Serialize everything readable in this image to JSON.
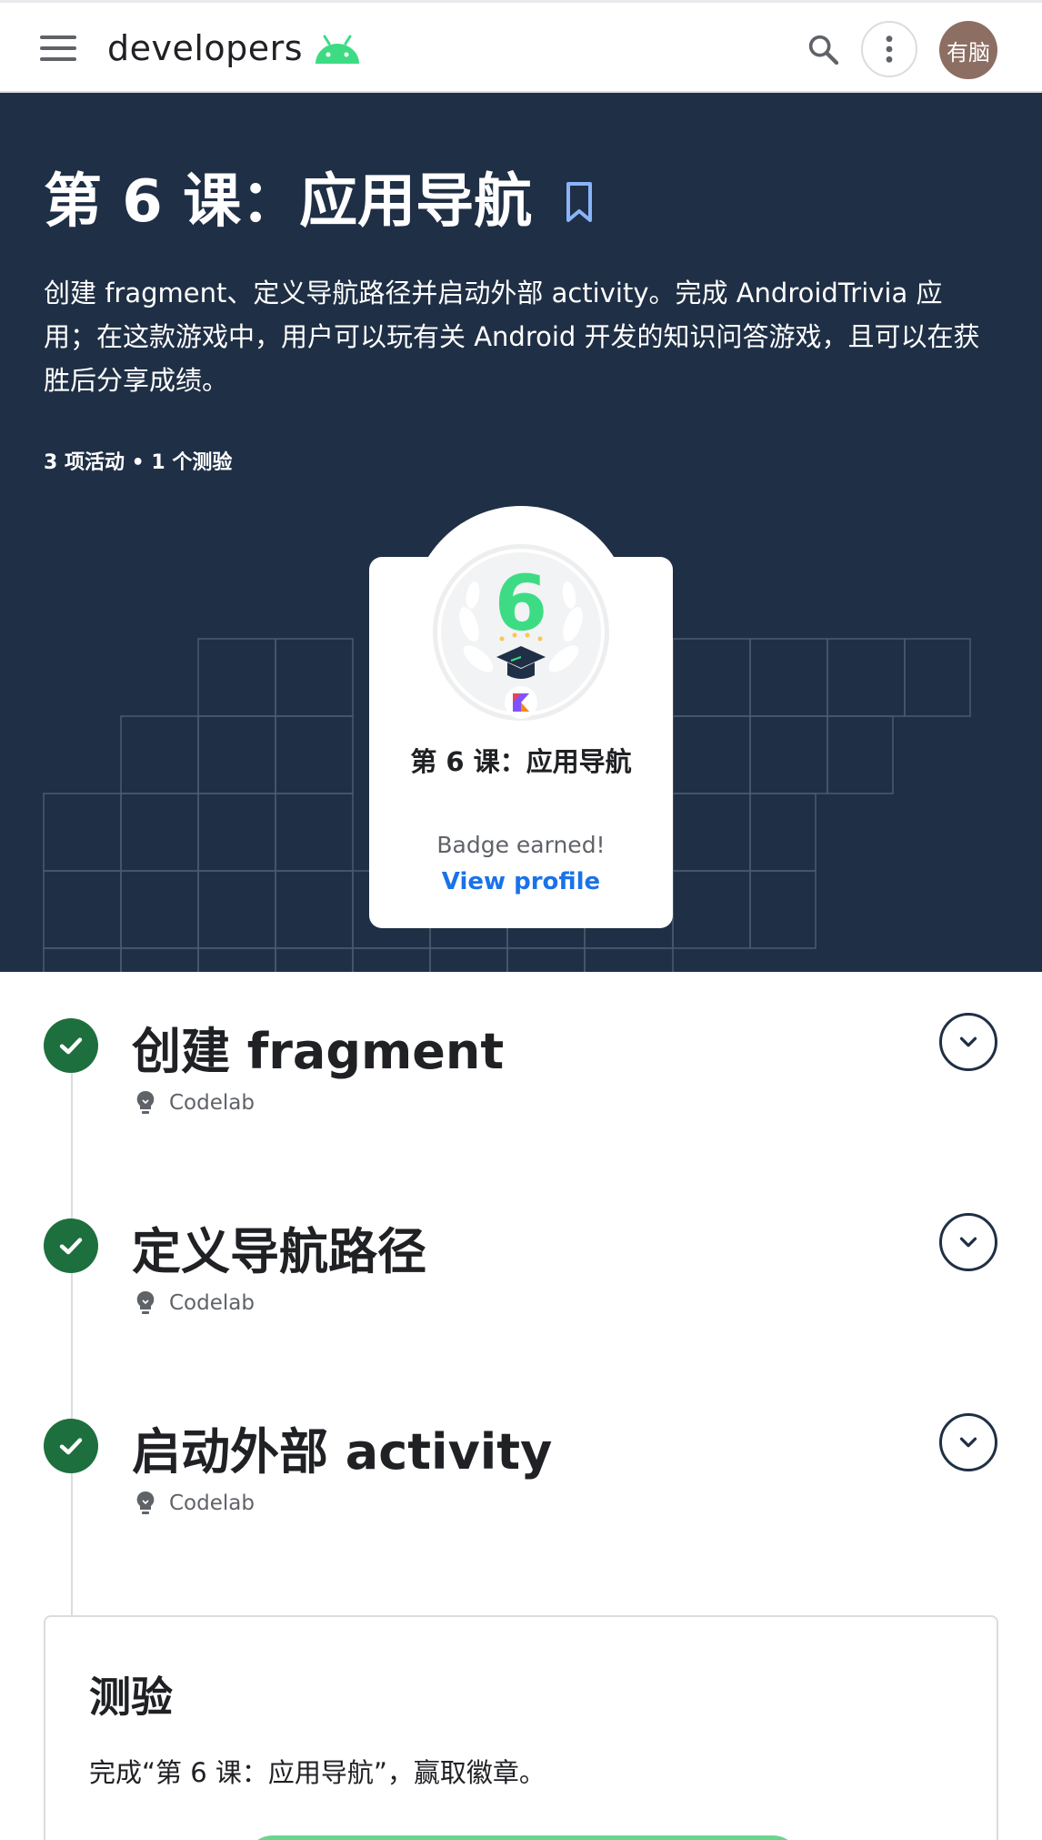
{
  "header": {
    "logo_text": "developers",
    "avatar_text": "有脑",
    "icons": [
      "menu-icon",
      "android-logo-icon",
      "search-icon",
      "more-vert-icon"
    ]
  },
  "hero": {
    "title": "第 6 课：应用导航",
    "description": "创建 fragment、定义导航路径并启动外部 activity。完成 AndroidTrivia 应用；在这款游戏中，用户可以玩有关 Android 开发的知识问答游戏，且可以在获胜后分享成绩。",
    "meta": "3 项活动 • 1 个测验",
    "badge": {
      "number": "6",
      "title": "第 6 课：应用导航",
      "status": "Badge earned!",
      "link": "View profile"
    }
  },
  "activities": [
    {
      "title": "创建 fragment",
      "type": "Codelab"
    },
    {
      "title": "定义导航路径",
      "type": "Codelab"
    },
    {
      "title": "启动外部 activity",
      "type": "Codelab"
    }
  ],
  "quiz": {
    "title": "测验",
    "description": "完成“第 6 课：应用导航”，赢取徽章。"
  },
  "colors": {
    "hero_bg": "#1f2f45",
    "check_green": "#1e6f3e",
    "link_blue": "#1a73e8",
    "android_green": "#3ddc84"
  }
}
